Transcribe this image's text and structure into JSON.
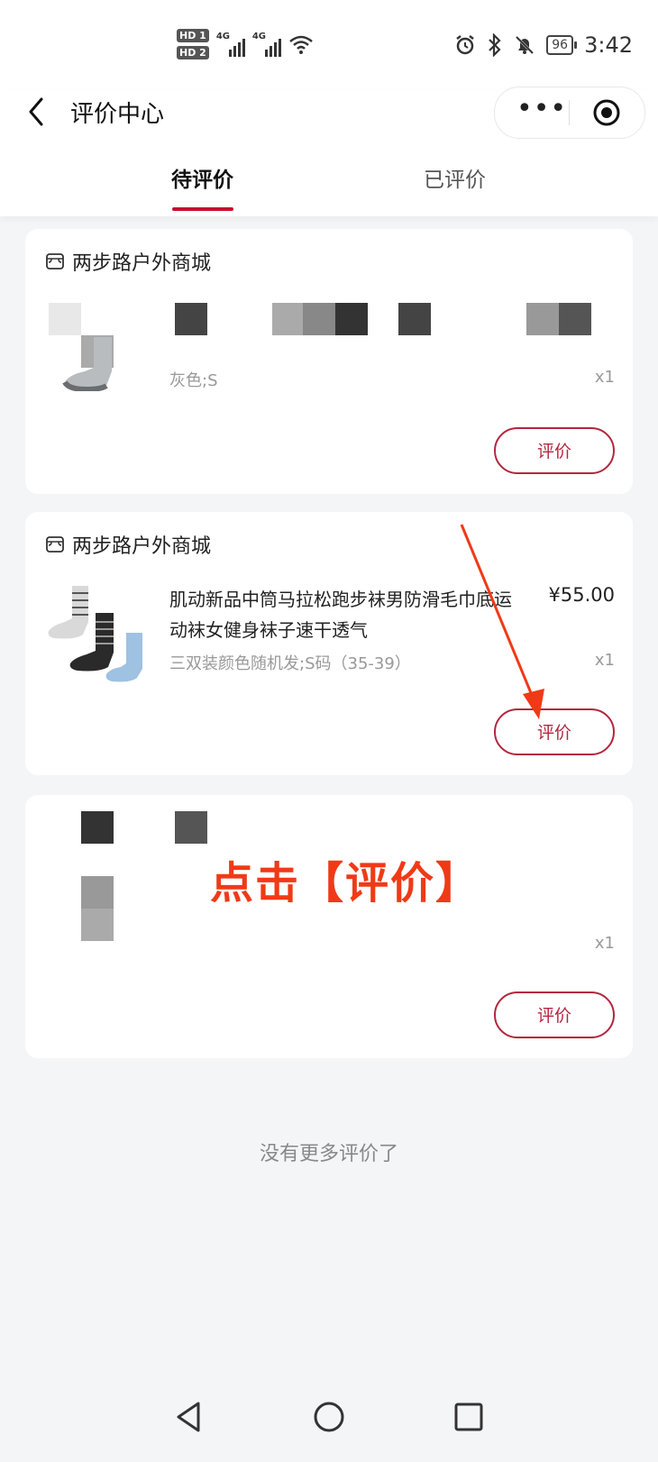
{
  "status_bar": {
    "hd1": "HD 1",
    "hd2": "HD 2",
    "net1": "4G",
    "net2": "4G",
    "battery": "96",
    "time": "3:42"
  },
  "nav": {
    "title": "评价中心",
    "back_icon": "chevron-left-icon",
    "more_icon": "more-dots-icon",
    "target_icon": "target-icon"
  },
  "tabs": [
    {
      "label": "待评价",
      "active": true
    },
    {
      "label": "已评价",
      "active": false
    }
  ],
  "orders": [
    {
      "shop": "两步路户外商城",
      "product_name": "",
      "price": "",
      "spec": "灰色;S",
      "qty": "x1",
      "button": "评价"
    },
    {
      "shop": "两步路户外商城",
      "product_name": "肌动新品中筒马拉松跑步袜男防滑毛巾底运动袜女健身袜子速干透气",
      "price": "¥55.00",
      "spec": "三双装颜色随机发;S码（35-39）",
      "qty": "x1",
      "button": "评价"
    },
    {
      "shop": "",
      "product_name": "",
      "price": "",
      "spec": "",
      "qty": "x1",
      "button": "评价"
    }
  ],
  "footer": {
    "no_more": "没有更多评价了"
  },
  "annotation": {
    "callout": "点击【评价】",
    "color": "#f03a17"
  },
  "colors": {
    "accent": "#c8102e",
    "button_border": "#b3263e",
    "background": "#f4f5f7"
  }
}
